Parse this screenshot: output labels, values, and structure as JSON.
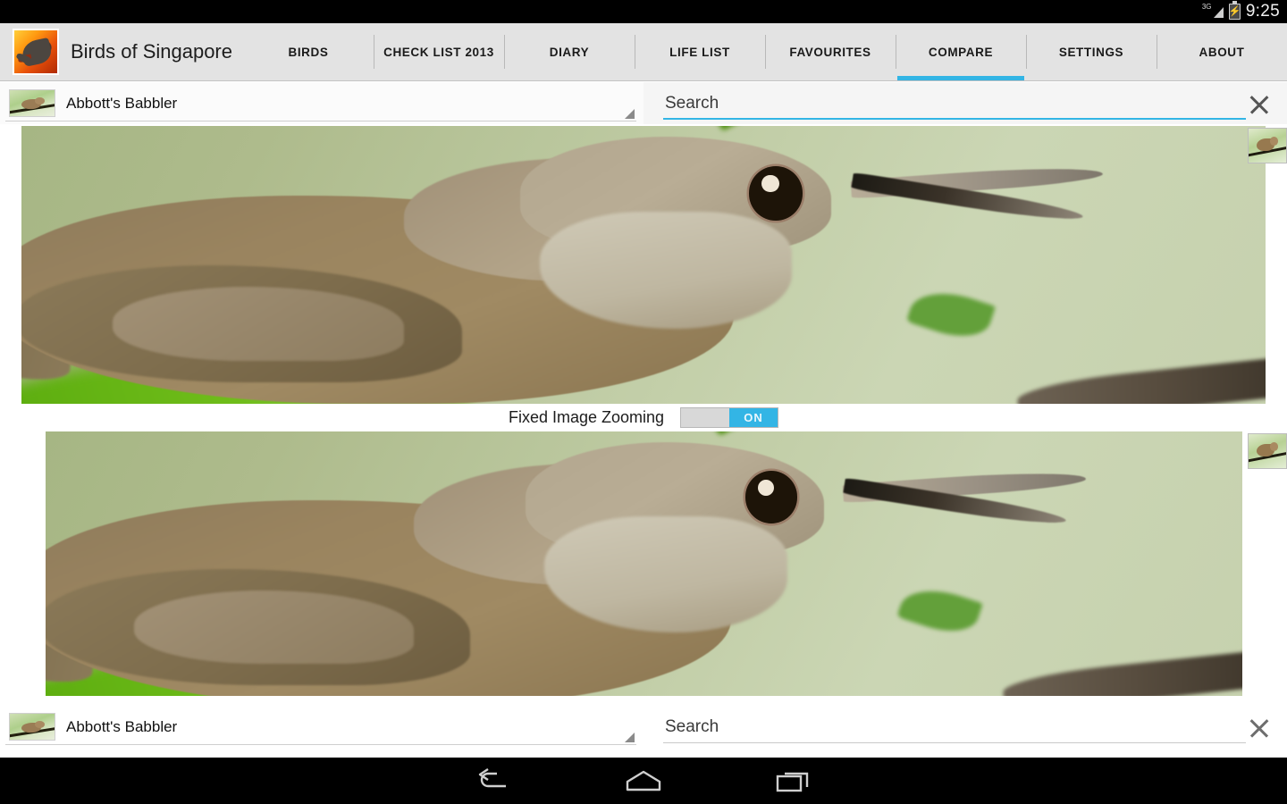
{
  "status_bar": {
    "network_label": "3G",
    "signal_icon": "signal-3g-icon",
    "battery_icon": "battery-charging-icon",
    "time": "9:25"
  },
  "action_bar": {
    "logo_icon": "app-logo-bird-icon",
    "app_title": "Birds of Singapore",
    "active_tab": "COMPARE",
    "accent_color": "#33b5e5",
    "tabs": [
      {
        "label": "BIRDS",
        "active": false
      },
      {
        "label": "CHECK LIST 2013",
        "active": false
      },
      {
        "label": "DIARY",
        "active": false
      },
      {
        "label": "LIFE LIST",
        "active": false
      },
      {
        "label": "FAVOURITES",
        "active": false
      },
      {
        "label": "COMPARE",
        "active": true
      },
      {
        "label": "SETTINGS",
        "active": false
      },
      {
        "label": "ABOUT",
        "active": false
      }
    ]
  },
  "top_selector": {
    "thumbnail_icon": "bird-thumbnail-icon",
    "species": "Abbott's Babbler",
    "dropdown_icon": "spinner-caret-icon",
    "search_placeholder": "Search",
    "search_value": "",
    "clear_icon": "close-icon",
    "focused": true
  },
  "bottom_selector": {
    "thumbnail_icon": "bird-thumbnail-icon",
    "species": "Abbott's Babbler",
    "dropdown_icon": "spinner-caret-icon",
    "search_placeholder": "Search",
    "search_value": "",
    "clear_icon": "close-icon",
    "focused": false
  },
  "compare": {
    "zoom_toggle_label": "Fixed Image Zooming",
    "zoom_toggle_state": "ON",
    "top_image_alt": "Abbott's Babbler",
    "bottom_image_alt": "Abbott's Babbler",
    "corner_thumb_icon": "bird-thumbnail-icon"
  },
  "nav_bar": {
    "back_icon": "back-arrow-icon",
    "home_icon": "home-icon",
    "recents_icon": "recent-apps-icon"
  }
}
